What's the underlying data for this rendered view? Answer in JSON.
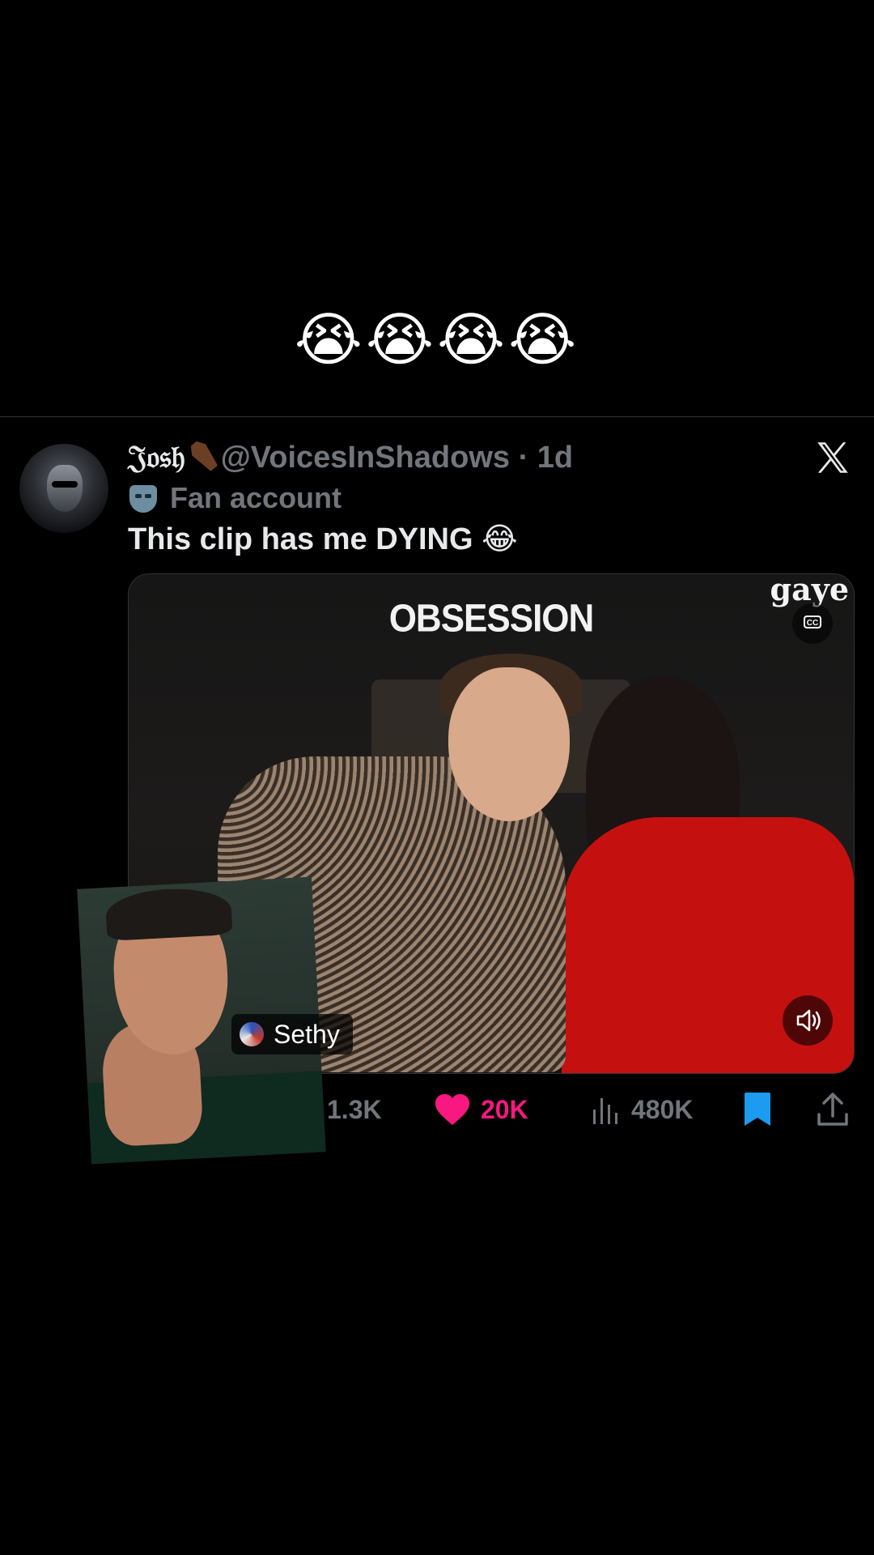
{
  "caption": "😭😭😭😭",
  "tweet": {
    "display_name": "𝔍𝔬𝔰𝔥",
    "handle": "@VoicesInShadows",
    "separator": "·",
    "time": "1d",
    "badge": "Fan account",
    "text": "This clip has me DYING 😂",
    "media": {
      "title_overlay": "OBSESSION",
      "brand_overlay": "gaye",
      "cc_label": "CC"
    },
    "actions": {
      "retweets": "1.3K",
      "likes": "20K",
      "views": "480K"
    }
  },
  "overlay": {
    "creator_tag": "Sethy"
  },
  "colors": {
    "like": "#f91880",
    "bookmark": "#1d9bf0",
    "muted": "#71767b"
  }
}
